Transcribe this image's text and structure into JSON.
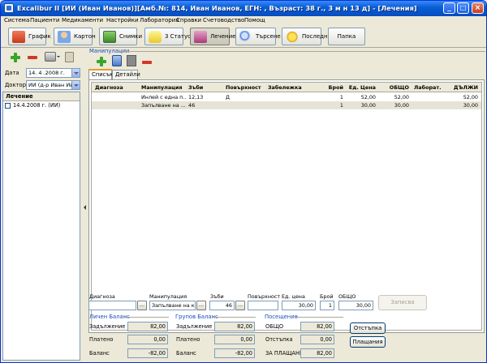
{
  "window": {
    "title": "Excalibur II [ИИ (Иван Иванов)][Амб.№: 814, Иван Иванов, ЕГН: , Възраст: 38 г., 3 м н 13 д] - [Лечения]",
    "minimize": "_",
    "restore": "□",
    "close": "×"
  },
  "menu": [
    "Система",
    "Пациенти",
    "Медикаменти",
    "Настройки",
    "Лаборатория",
    "Справки",
    "Счетоводство",
    "Помощ"
  ],
  "toolbar": [
    {
      "label": "График",
      "icon": "calendar-icon",
      "color": "#e2553a"
    },
    {
      "label": "Картон",
      "icon": "patient-card-icon",
      "color": "#7aa8e8"
    },
    {
      "label": "Снимки",
      "icon": "xray-images-icon",
      "color": "#5aa04a"
    },
    {
      "label": "3 Статус",
      "icon": "tooth-status-icon",
      "color": "#e8d24a"
    },
    {
      "label": "Лечение",
      "icon": "treatment-icon",
      "color": "#c85a9a"
    },
    {
      "label": "Търсене",
      "icon": "search-icon",
      "color": "#5a8ae8"
    },
    {
      "label": "Последни",
      "icon": "recent-icon",
      "color": "#e8c83a"
    },
    {
      "label": "Папка",
      "icon": "folder-icon",
      "color": ""
    }
  ],
  "left": {
    "date_label": "Дата",
    "date_value": "14. 4 .2008 г.",
    "doctor_label": "Доктор",
    "doctor_value": "ИИ (д-р Иван Иван",
    "tree_header": "Лечение",
    "tree_items": [
      "14.4.2008 г. (ИИ)"
    ]
  },
  "main": {
    "group_title": "Манипулации",
    "tabs": [
      "Списък",
      "Детайли"
    ],
    "columns": [
      "Диагноза",
      "Манипулация",
      "Зъби",
      "Повърхност",
      "Забележка",
      "Брой",
      "Ед. Цена",
      "ОБЩО",
      "Лаборат.",
      "ДЪЛЖИ"
    ],
    "rows": [
      {
        "diagnosis": "",
        "manipulation": "Инлей с една п...",
        "teeth": "12,13",
        "surface": "Д",
        "note": "",
        "count": "1",
        "price": "52,00",
        "total": "52,00",
        "lab": "",
        "owed": "52,00"
      },
      {
        "diagnosis": "",
        "manipulation": "Запълване на ...",
        "teeth": "46",
        "surface": "",
        "note": "",
        "count": "1",
        "price": "30,00",
        "total": "30,00",
        "lab": "",
        "owed": "30,00"
      }
    ]
  },
  "edit": {
    "diag_label": "Диагноза",
    "diag_value": "",
    "manip_label": "Манипулация",
    "manip_value": "Запълване на коре",
    "teeth_label": "Зъби",
    "teeth_value": "46",
    "surface_label": "Повърхност",
    "surface_value": "",
    "price_label": "Ед. цена",
    "price_value": "30,00",
    "count_label": "Брой",
    "count_value": "1",
    "total_label": "ОБЩО",
    "total_value": "30,00",
    "ellipsis": "...",
    "save_button": "Записва"
  },
  "balances": {
    "personal": {
      "title": "Личен Баланс",
      "debt_label": "Задължение",
      "debt": "82,00",
      "paid_label": "Платено",
      "paid": "0,00",
      "balance_label": "Баланс",
      "balance": "-82,00"
    },
    "group": {
      "title": "Групов Баланс",
      "debt_label": "Задължение",
      "debt": "82,00",
      "paid_label": "Платено",
      "paid": "0,00",
      "balance_label": "Баланс",
      "balance": "-82,00"
    },
    "visit": {
      "title": "Посещение",
      "total_label": "ОБЩО",
      "total": "82,00",
      "discount_label": "Отстъпка",
      "discount": "0,00",
      "topay_label": "ЗА ПЛАЩАНЕ",
      "topay": "82,00"
    },
    "discount_button": "Отстъпка",
    "payments_button": "Плащания"
  }
}
